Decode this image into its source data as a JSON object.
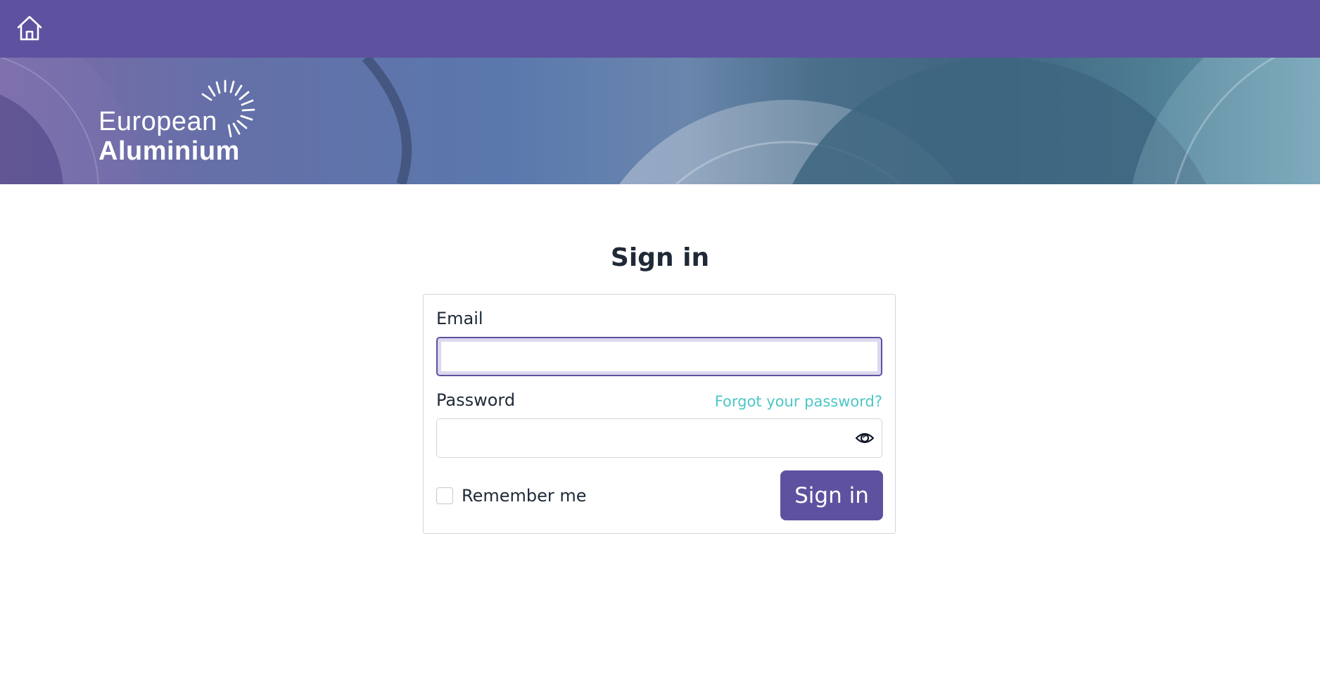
{
  "topbar": {
    "home_icon": "home-icon",
    "background": "#5e519f"
  },
  "banner": {
    "logo": {
      "line1": "European",
      "line2": "Aluminium",
      "icon": "sunburst-logo-icon"
    }
  },
  "page": {
    "title": "Sign in"
  },
  "form": {
    "email_label": "Email",
    "email_value": "",
    "password_label": "Password",
    "password_value": "",
    "forgot_link": "Forgot your password?",
    "show_password_icon": "eye-icon",
    "remember_label": "Remember me",
    "remember_checked": false,
    "submit_label": "Sign in"
  },
  "colors": {
    "accent": "#5e519f",
    "link": "#4cc6c6",
    "text": "#1f2937"
  }
}
